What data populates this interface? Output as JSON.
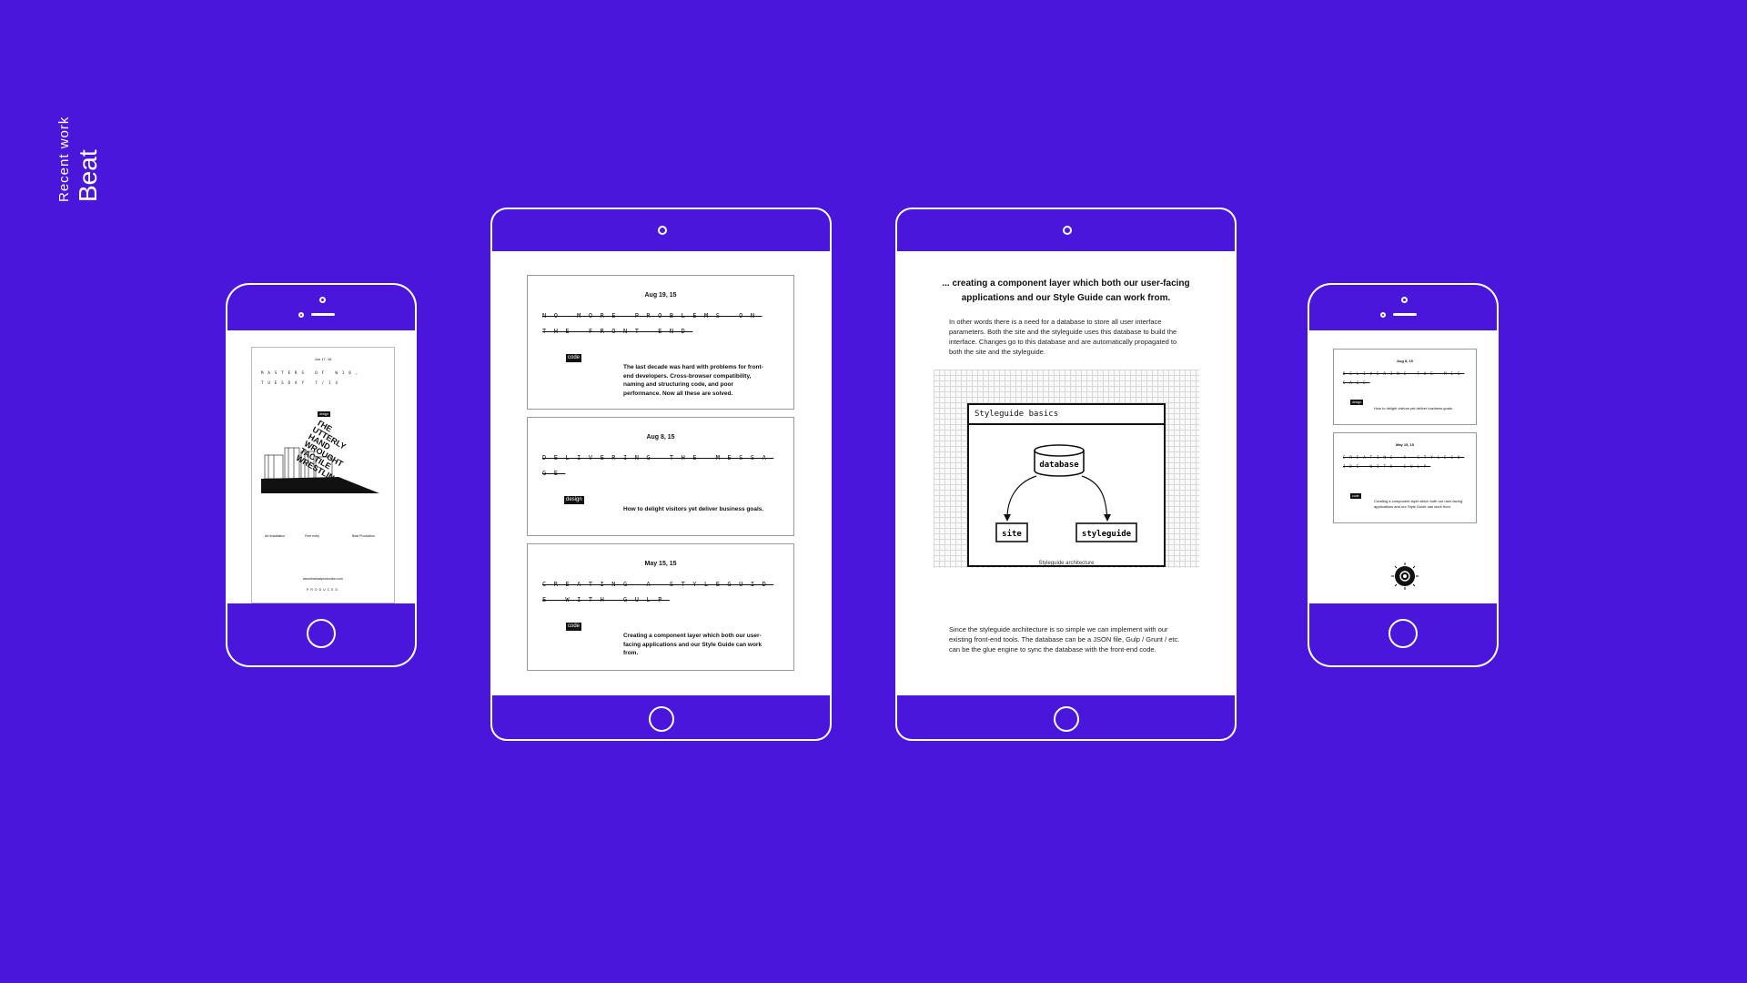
{
  "header": {
    "kicker": "Recent work",
    "title": "Beat"
  },
  "colors": {
    "background": "#4a16dc",
    "screen": "#ffffff",
    "ink": "#111111"
  },
  "phone_left": {
    "poster": {
      "date": "Jun 17, 16",
      "title": "Masters of W10, Tuesday 7/14",
      "tag": "design",
      "headline": "The Utterly Hand Wrought Tactile Wrestling",
      "col1": "Art Installation",
      "col2": "Free entry",
      "col3": "Beat Production",
      "footer_link": "www.thebeatproduction.com",
      "footer_mark": "PRODUCED"
    }
  },
  "tablet_list": {
    "cards": [
      {
        "date": "Aug 19, 15",
        "title": "No more problems on the front end",
        "tag": "code",
        "excerpt": "The last decade was hard with problems for front-end developers. Cross-browser compatibility, naming and structuring code, and poor performance. Now all these are solved."
      },
      {
        "date": "Aug 8, 15",
        "title": "Delivering the message",
        "tag": "design",
        "excerpt": "How to delight visitors yet deliver business goals."
      },
      {
        "date": "May 15, 15",
        "title": "Creating a styleguide with gulp",
        "tag": "code",
        "excerpt": "Creating a component layer which both our user-facing applications and our Style Guide can work from."
      }
    ]
  },
  "tablet_article": {
    "heading": "... creating a component layer which both our user-facing applications and our Style Guide can work from.",
    "intro": "In other words there is a need for a database to store all user interface parameters. Both the site and the styleguide uses this database to build the interface. Changes go to this database and are automatically propagated to both the site and the styleguide.",
    "diagram": {
      "window_title": "Styleguide basics",
      "db_label": "database",
      "site_label": "site",
      "styleguide_label": "styleguide",
      "caption": "Styleguide architecture"
    },
    "outro": "Since the styleguide architecture is so simple we can implement with our existing front-end tools. The database can be a JSON file, Gulp / Grunt / etc. can be the glue engine to sync the database with the front-end code."
  },
  "phone_right": {
    "cards": [
      {
        "date": "Aug 8, 15",
        "title": "Delivering the message",
        "tag": "design",
        "excerpt": "How to delight visitors yet deliver business goals."
      },
      {
        "date": "May 15, 15",
        "title": "Creating a styleguide with gulp",
        "tag": "code",
        "excerpt": "Creating a component layer which both our user-facing applications and our Style Guide can work from."
      }
    ]
  }
}
